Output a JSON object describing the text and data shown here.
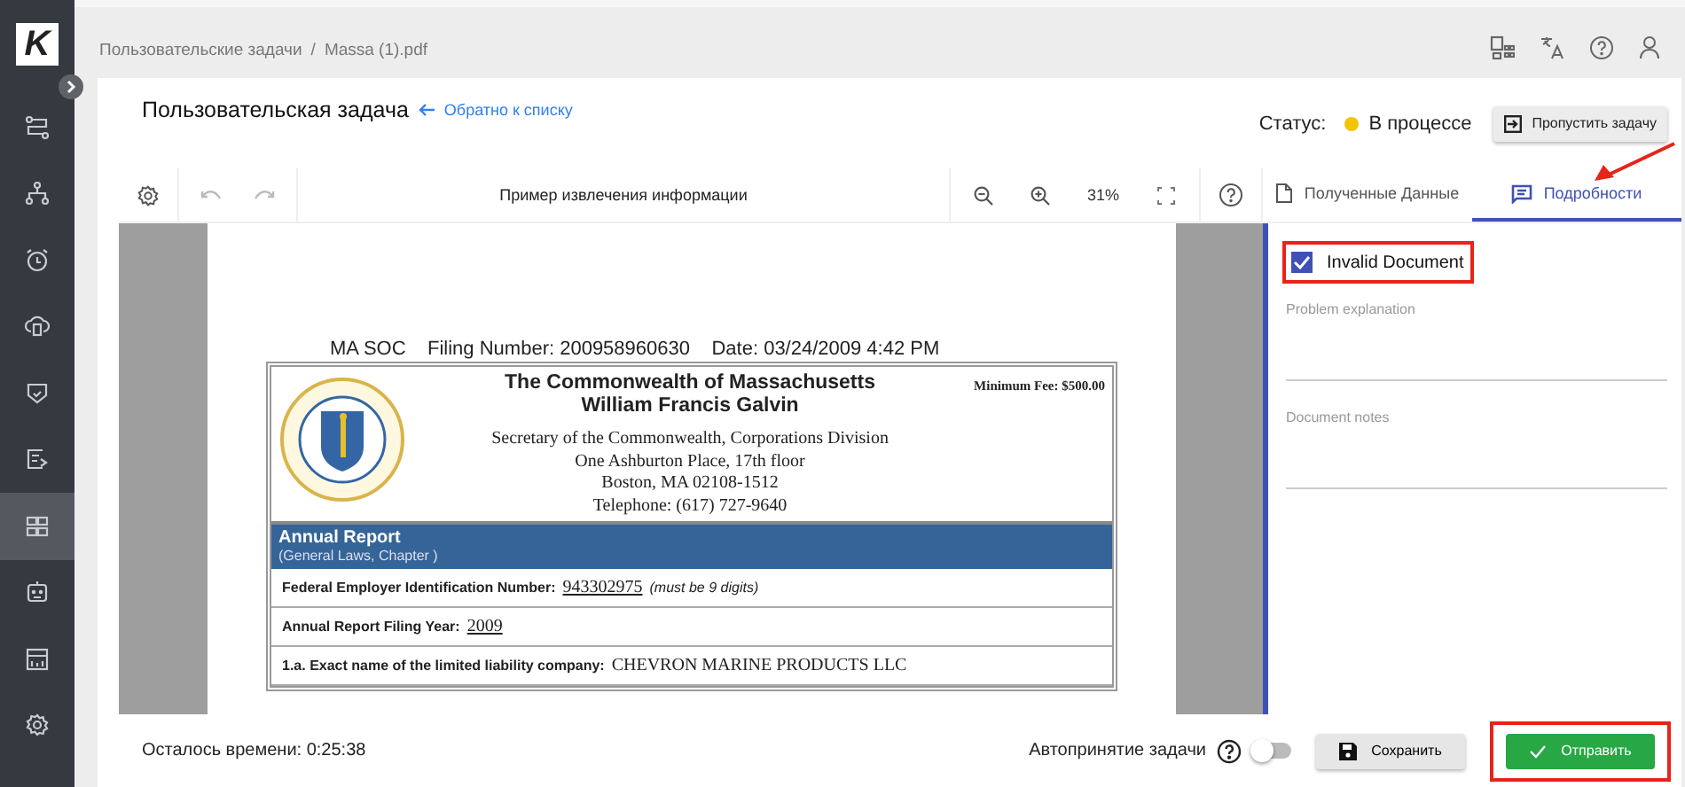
{
  "sidebar": {
    "logo": "K",
    "items": [
      {
        "kind": "routes",
        "selected": false
      },
      {
        "kind": "tree",
        "selected": false
      },
      {
        "kind": "alarm",
        "selected": false
      },
      {
        "kind": "cloud",
        "selected": false
      },
      {
        "kind": "shield",
        "selected": false
      },
      {
        "kind": "doc",
        "selected": false
      },
      {
        "kind": "grid",
        "selected": true
      },
      {
        "kind": "robot",
        "selected": false
      },
      {
        "kind": "calendar",
        "selected": false
      },
      {
        "kind": "gear",
        "selected": false
      }
    ]
  },
  "breadcrumb": [
    "Пользовательские задачи",
    "/",
    "Massa (1).pdf"
  ],
  "header": {
    "title": "Пользовательская задача",
    "back_link": "Обратно к списку",
    "status_label": "Статус:",
    "status": "В процессе",
    "skip_button": "Пропустить задачу"
  },
  "toolbar": {
    "title": "Пример извлечения информации",
    "zoom": "31%"
  },
  "tabs": [
    {
      "label": "Полученные Данные",
      "selected": false
    },
    {
      "label": "Подробности",
      "selected": true
    }
  ],
  "document": {
    "filing_line": "MA SOC    Filing Number: 200958960630    Date: 03/24/2009 4:42 PM",
    "title_lines": [
      "The Commonwealth of Massachusetts",
      "William Francis Galvin"
    ],
    "fee": "Minimum Fee: $500.00",
    "address_lines": [
      "Secretary of the Commonwealth, Corporations Division",
      "One Ashburton Place, 17th floor",
      "Boston, MA 02108-1512",
      "Telephone: (617) 727-9640"
    ],
    "band_title": "Annual Report",
    "band_subtitle": "(General Laws, Chapter )",
    "rows": [
      {
        "label": "Federal Employer Identification Number:",
        "value": "943302975",
        "note": "(must be 9 digits)"
      },
      {
        "label": "Annual Report Filing Year:",
        "value": "2009"
      },
      {
        "label": "1.a. Exact name of the limited liability company:",
        "value": "CHEVRON MARINE PRODUCTS LLC"
      }
    ]
  },
  "details": {
    "invalid_checkbox": {
      "label": "Invalid Document",
      "checked": true,
      "highlighted": true
    },
    "fields": [
      {
        "label": "Problem explanation"
      },
      {
        "label": "Document notes"
      }
    ]
  },
  "footer": {
    "time_left": "Осталось времени: 0:25:38",
    "auto_accept": {
      "label": "Автопринятие задачи",
      "on": false
    },
    "save_button": "Сохранить",
    "send_button": {
      "label": "Отправить",
      "highlighted": true
    }
  }
}
